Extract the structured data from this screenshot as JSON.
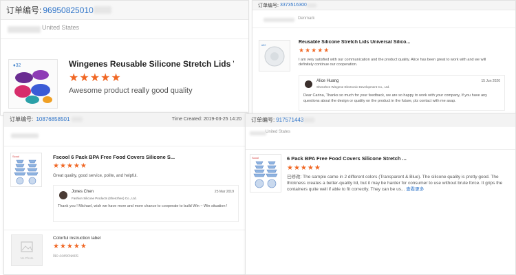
{
  "order_prefix": "订单编号:",
  "card1": {
    "order_no": "96950825010",
    "country": "United States",
    "title": "Wingenes Reusable Silicone Stretch Lids Vacu...",
    "stars": "★★★★★",
    "review": "Awesome product really good quality"
  },
  "card2": {
    "order_no": "3373516300",
    "country": "Denmark",
    "title": "Reusable Silicone Stretch Lids Universal Silico...",
    "stars": "★★★★★",
    "review": "I am very satisfied with our communication and the product quality. Alice has been great to work with and we will definitely continue our cooperation.",
    "reply": {
      "name": "Alice Huang",
      "company": "Shenzhen Wingene Electronic Development Co., Ltd.",
      "date": "15 Jun 2020",
      "text": "Dear Carina, Thanks so much for your feedback, we are so happy to work with your company, If you have any questions about the design or quality on the product in the future, plz contact with me asap."
    }
  },
  "card3": {
    "order_no": "10876858501",
    "time_created": "Time Created: 2019-03-25 14:20",
    "title": "Fscool 6 Pack BPA Free Food Covers Silicone S...",
    "stars": "★★★★★",
    "review": "Great quality, good service, polite, and helpful.",
    "reply": {
      "name": "Jones Chen",
      "company": "Fashion Silicone Products (Shenzhen) Co., Ltd.",
      "date": "25 Mar 2019",
      "text": "Thank you ! Michael, wish we have more and more chance to cooperate to build Win ~ Win situation !"
    },
    "item2": {
      "title": "Colorful instruction label",
      "stars": "★★★★★",
      "no_photo": "No Photo",
      "note": "No comments"
    }
  },
  "card4": {
    "order_no": "917571443",
    "country": "United States",
    "title": "6 Pack BPA Free Food Covers Silicone Stretch ...",
    "stars": "★★★★★",
    "review_prefix": "已修改:",
    "review": "The sample came in 2 different colors (Transparent & Blue). The silicone quality is pretty good. The thickness creates a better-quality lid, but it may be harder for consumer to use without brute force.  It grips the containers quite well if able to fit correctly.  They can be us...",
    "more": "查看更多"
  },
  "colors": {
    "star": "#f06724",
    "link": "#2d73c8",
    "header_bg": "#f5f5f5"
  }
}
